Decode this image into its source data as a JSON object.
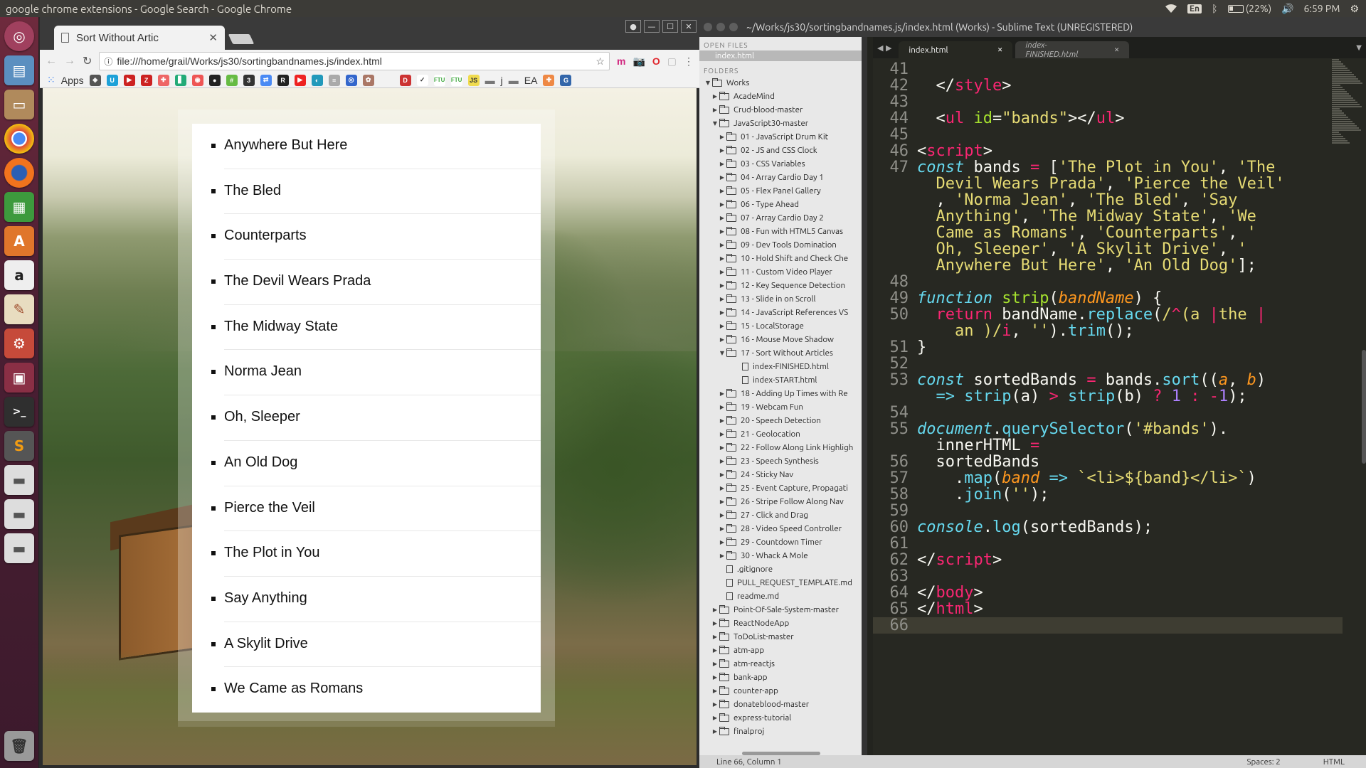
{
  "topbar": {
    "window_title": "google chrome extensions - Google Search - Google Chrome",
    "lang": "En",
    "battery": "(22%)",
    "time": "6:59 PM"
  },
  "launcher": {
    "items": [
      "ubuntu-dash",
      "files",
      "file-manager",
      "chrome",
      "firefox",
      "spreadsheet",
      "software-center",
      "amazon",
      "text-editor",
      "settings",
      "workspace",
      "terminal",
      "sublime",
      "drive",
      "drive",
      "drive",
      "trash"
    ]
  },
  "chrome": {
    "tab_title": "Sort Without Artic",
    "url": "file:///home/grail/Works/js30/sortingbandnames.js/index.html",
    "bookmarks_apps": "Apps",
    "bookmark_folder_j": "j",
    "bookmark_folder_ea": "EA",
    "bands": [
      "Anywhere But Here",
      "The Bled",
      "Counterparts",
      "The Devil Wears Prada",
      "The Midway State",
      "Norma Jean",
      "Oh, Sleeper",
      "An Old Dog",
      "Pierce the Veil",
      "The Plot in You",
      "Say Anything",
      "A Skylit Drive",
      "We Came as Romans"
    ]
  },
  "sublime": {
    "title": "~/Works/js30/sortingbandnames.js/index.html (Works) - Sublime Text (UNREGISTERED)",
    "open_files_label": "OPEN FILES",
    "open_file": "index.html",
    "folders_label": "FOLDERS",
    "tree": [
      {
        "t": "Works",
        "d": 0,
        "k": "fo",
        "open": true
      },
      {
        "t": "AcadeMind",
        "d": 1,
        "k": "fc"
      },
      {
        "t": "Crud-blood-master",
        "d": 1,
        "k": "fc"
      },
      {
        "t": "JavaScript30-master",
        "d": 1,
        "k": "fo",
        "open": true
      },
      {
        "t": "01 - JavaScript Drum Kit",
        "d": 2,
        "k": "fc"
      },
      {
        "t": "02 - JS and CSS Clock",
        "d": 2,
        "k": "fc"
      },
      {
        "t": "03 - CSS Variables",
        "d": 2,
        "k": "fc"
      },
      {
        "t": "04 - Array Cardio Day 1",
        "d": 2,
        "k": "fc"
      },
      {
        "t": "05 - Flex Panel Gallery",
        "d": 2,
        "k": "fc"
      },
      {
        "t": "06 - Type Ahead",
        "d": 2,
        "k": "fc"
      },
      {
        "t": "07 - Array Cardio Day 2",
        "d": 2,
        "k": "fc"
      },
      {
        "t": "08 - Fun with HTML5 Canvas",
        "d": 2,
        "k": "fc"
      },
      {
        "t": "09 - Dev Tools Domination",
        "d": 2,
        "k": "fc"
      },
      {
        "t": "10 - Hold Shift and Check Che",
        "d": 2,
        "k": "fc"
      },
      {
        "t": "11 - Custom Video Player",
        "d": 2,
        "k": "fc"
      },
      {
        "t": "12 - Key Sequence Detection",
        "d": 2,
        "k": "fc"
      },
      {
        "t": "13 - Slide in on Scroll",
        "d": 2,
        "k": "fc"
      },
      {
        "t": "14 - JavaScript References VS",
        "d": 2,
        "k": "fc"
      },
      {
        "t": "15 - LocalStorage",
        "d": 2,
        "k": "fc"
      },
      {
        "t": "16 - Mouse Move Shadow",
        "d": 2,
        "k": "fc"
      },
      {
        "t": "17 - Sort Without Articles",
        "d": 2,
        "k": "fo",
        "open": true
      },
      {
        "t": "index-FINISHED.html",
        "d": 3,
        "k": "f"
      },
      {
        "t": "index-START.html",
        "d": 3,
        "k": "f"
      },
      {
        "t": "18 - Adding Up Times with Re",
        "d": 2,
        "k": "fc"
      },
      {
        "t": "19 - Webcam Fun",
        "d": 2,
        "k": "fc"
      },
      {
        "t": "20 - Speech Detection",
        "d": 2,
        "k": "fc"
      },
      {
        "t": "21 - Geolocation",
        "d": 2,
        "k": "fc"
      },
      {
        "t": "22 - Follow Along Link Highligh",
        "d": 2,
        "k": "fc"
      },
      {
        "t": "23 - Speech Synthesis",
        "d": 2,
        "k": "fc"
      },
      {
        "t": "24 - Sticky Nav",
        "d": 2,
        "k": "fc"
      },
      {
        "t": "25 - Event Capture, Propagati",
        "d": 2,
        "k": "fc"
      },
      {
        "t": "26 - Stripe Follow Along Nav",
        "d": 2,
        "k": "fc"
      },
      {
        "t": "27 - Click and Drag",
        "d": 2,
        "k": "fc"
      },
      {
        "t": "28 - Video Speed Controller",
        "d": 2,
        "k": "fc"
      },
      {
        "t": "29 - Countdown Timer",
        "d": 2,
        "k": "fc"
      },
      {
        "t": "30 - Whack A Mole",
        "d": 2,
        "k": "fc"
      },
      {
        "t": ".gitignore",
        "d": 2,
        "k": "f"
      },
      {
        "t": "PULL_REQUEST_TEMPLATE.md",
        "d": 2,
        "k": "f"
      },
      {
        "t": "readme.md",
        "d": 2,
        "k": "f"
      },
      {
        "t": "Point-Of-Sale-System-master",
        "d": 1,
        "k": "fc"
      },
      {
        "t": "ReactNodeApp",
        "d": 1,
        "k": "fc"
      },
      {
        "t": "ToDoList-master",
        "d": 1,
        "k": "fc"
      },
      {
        "t": "atm-app",
        "d": 1,
        "k": "fc"
      },
      {
        "t": "atm-reactjs",
        "d": 1,
        "k": "fc"
      },
      {
        "t": "bank-app",
        "d": 1,
        "k": "fc"
      },
      {
        "t": "counter-app",
        "d": 1,
        "k": "fc"
      },
      {
        "t": "donateblood-master",
        "d": 1,
        "k": "fc"
      },
      {
        "t": "express-tutorial",
        "d": 1,
        "k": "fc"
      },
      {
        "t": "finalproj",
        "d": 1,
        "k": "fc"
      }
    ],
    "tabs": [
      {
        "label": "index.html",
        "active": true
      },
      {
        "label": "index-FINISHED.html",
        "active": false
      }
    ],
    "code_lines": [
      {
        "n": "41",
        "h": ""
      },
      {
        "n": "42",
        "h": "  &lt;/<span class='tg'>style</span>&gt;"
      },
      {
        "n": "43",
        "h": ""
      },
      {
        "n": "44",
        "h": "  &lt;<span class='tg'>ul</span> <span class='at'>id</span>=<span class='st'>\"bands\"</span>&gt;&lt;/<span class='tg'>ul</span>&gt;"
      },
      {
        "n": "45",
        "h": ""
      },
      {
        "n": "46",
        "h": "&lt;<span class='tg'>script</span>&gt;"
      },
      {
        "n": "47",
        "h": "<span class='it'>const</span> bands <span class='kw'>=</span> [<span class='st'>'The Plot in You'</span>, <span class='st'>'The</span>"
      },
      {
        "n": "",
        "h": "  <span class='st'>Devil Wears Prada'</span>, <span class='st'>'Pierce the Veil'</span>"
      },
      {
        "n": "",
        "h": "  , <span class='st'>'Norma Jean'</span>, <span class='st'>'The Bled'</span>, <span class='st'>'Say</span>"
      },
      {
        "n": "",
        "h": "  <span class='st'>Anything'</span>, <span class='st'>'The Midway State'</span>, <span class='st'>'We</span>"
      },
      {
        "n": "",
        "h": "  <span class='st'>Came as Romans'</span>, <span class='st'>'Counterparts'</span>, <span class='st'>'</span>"
      },
      {
        "n": "",
        "h": "  <span class='st'>Oh, Sleeper'</span>, <span class='st'>'A Skylit Drive'</span>, <span class='st'>'</span>"
      },
      {
        "n": "",
        "h": "  <span class='st'>Anywhere But Here'</span>, <span class='st'>'An Old Dog'</span>];"
      },
      {
        "n": "48",
        "h": ""
      },
      {
        "n": "49",
        "h": "<span class='it'>function</span> <span class='fn'>strip</span>(<span class='pa'>bandName</span>) {"
      },
      {
        "n": "50",
        "h": "  <span class='kw'>return</span> bandName.<span class='bi'>replace</span>(<span class='st'>/</span><span class='kw'>^</span><span class='st'>(a </span><span class='kw'>|</span><span class='st'>the </span><span class='kw'>|</span>"
      },
      {
        "n": "",
        "h": "    <span class='st'>an )/</span><span class='kw'>i</span>, <span class='st'>''</span>).<span class='bi'>trim</span>();"
      },
      {
        "n": "51",
        "h": "}"
      },
      {
        "n": "52",
        "h": ""
      },
      {
        "n": "53",
        "h": "<span class='it'>const</span> sortedBands <span class='kw'>=</span> bands.<span class='bi'>sort</span>((<span class='pa'>a</span>, <span class='pa'>b</span>)"
      },
      {
        "n": "",
        "h": "  <span class='it'>=&gt;</span> <span class='bi'>strip</span>(a) <span class='kw'>&gt;</span> <span class='bi'>strip</span>(b) <span class='kw'>?</span> <span class='nm'>1</span> <span class='kw'>:</span> <span class='kw'>-</span><span class='nm'>1</span>);"
      },
      {
        "n": "54",
        "h": ""
      },
      {
        "n": "55",
        "h": "<span class='it'>document</span>.<span class='bi'>querySelector</span>(<span class='st'>'#bands'</span>)."
      },
      {
        "n": "",
        "h": "  innerHTML <span class='kw'>=</span>"
      },
      {
        "n": "56",
        "h": "  sortedBands"
      },
      {
        "n": "57",
        "h": "    .<span class='bi'>map</span>(<span class='pa'>band</span> <span class='it'>=&gt;</span> <span class='st'>`&lt;li&gt;${band}&lt;/li&gt;`</span>)"
      },
      {
        "n": "58",
        "h": "    .<span class='bi'>join</span>(<span class='st'>''</span>);"
      },
      {
        "n": "59",
        "h": ""
      },
      {
        "n": "60",
        "h": "<span class='it'>console</span>.<span class='bi'>log</span>(sortedBands);"
      },
      {
        "n": "61",
        "h": ""
      },
      {
        "n": "62",
        "h": "&lt;/<span class='tg'>script</span>&gt;"
      },
      {
        "n": "63",
        "h": ""
      },
      {
        "n": "64",
        "h": "&lt;/<span class='tg'>body</span>&gt;"
      },
      {
        "n": "65",
        "h": "&lt;/<span class='tg'>html</span>&gt;"
      },
      {
        "n": "66",
        "h": ""
      }
    ],
    "status_left": "Line 66, Column 1",
    "status_spaces": "Spaces: 2",
    "status_syntax": "HTML"
  }
}
